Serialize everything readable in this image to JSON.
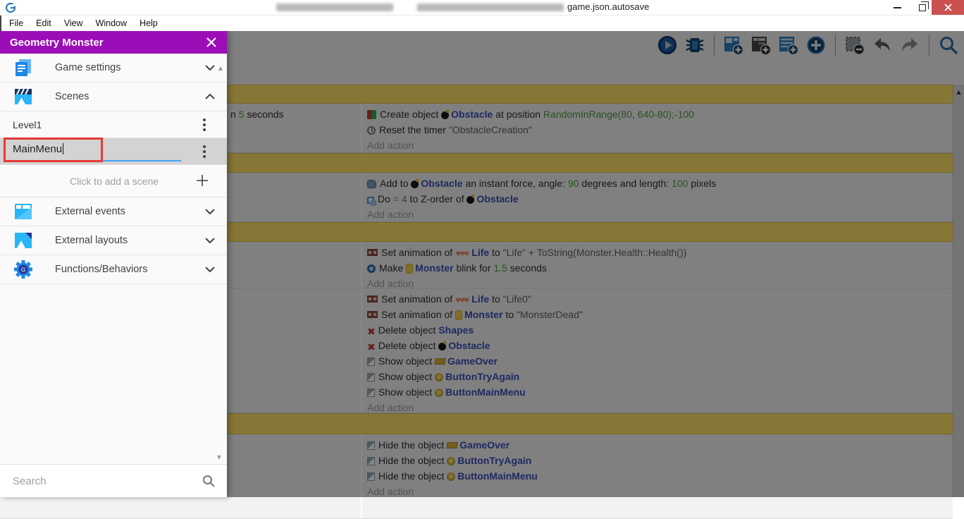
{
  "window": {
    "title": "game.json.autosave",
    "controls": [
      "minimize-button",
      "restore-button",
      "close-button"
    ]
  },
  "menu": {
    "items": [
      "File",
      "Edit",
      "View",
      "Window",
      "Help"
    ]
  },
  "toolbar": {
    "icons": [
      "play",
      "debug",
      "add-event",
      "add-subevent",
      "add-comment-event",
      "add-other-event",
      "remove-event",
      "undo",
      "redo",
      "search"
    ],
    "separators_after": [
      1,
      5,
      8
    ]
  },
  "sidebar": {
    "title": "Geometry Monster",
    "sections_top": [
      {
        "label": "Game settings",
        "icon": "game-settings-icon",
        "chevron": "down"
      },
      {
        "label": "Scenes",
        "icon": "scenes-icon",
        "chevron": "up"
      }
    ],
    "scenes": [
      {
        "label": "Level1",
        "editing": false
      },
      {
        "label": "MainMenu",
        "editing": true
      }
    ],
    "add_scene_label": "Click to add a scene",
    "sections_bottom": [
      {
        "label": "External events",
        "icon": "external-events-icon",
        "chevron": "down"
      },
      {
        "label": "External layouts",
        "icon": "external-layouts-icon",
        "chevron": "down"
      },
      {
        "label": "Functions/Behaviors",
        "icon": "functions-icon",
        "chevron": "down"
      }
    ],
    "search_placeholder": "Search"
  },
  "labels": {
    "add_action": "Add action"
  },
  "colors": {
    "drawer_header": "#9c0db7",
    "annotation": "#e53935",
    "edit_underline": "#42a5f5",
    "comment_bar": "#ffe066",
    "object_link": "#3a4fb4",
    "expression": "#4f9d3c",
    "close_button": "#cb5151"
  },
  "events": [
    {
      "type": "comment",
      "h": 27
    },
    {
      "type": "event",
      "h": 70,
      "conditions": [
        [
          {
            "t": "n "
          },
          {
            "t": "5",
            "k": "expr"
          },
          {
            "t": " seconds"
          }
        ]
      ],
      "actions": [
        {
          "icon": "create",
          "segs": [
            {
              "t": "Create object "
            },
            {
              "obj_icon": "bomb"
            },
            {
              "t": "Obstacle",
              "k": "obj"
            },
            {
              "t": " at position "
            },
            {
              "t": "RandomInRange(80, 640-80);-100",
              "k": "expr"
            }
          ]
        },
        {
          "icon": "timer",
          "segs": [
            {
              "t": "Reset the timer "
            },
            {
              "t": "\"ObstacleCreation\"",
              "k": "str"
            }
          ]
        }
      ]
    },
    {
      "type": "comment",
      "h": 28
    },
    {
      "type": "event",
      "h": 70,
      "conditions": [],
      "actions": [
        {
          "icon": "force",
          "segs": [
            {
              "t": "Add to "
            },
            {
              "obj_icon": "bomb"
            },
            {
              "t": "Obstacle",
              "k": "obj"
            },
            {
              "t": " an instant force, angle: "
            },
            {
              "t": "90",
              "k": "expr"
            },
            {
              "t": " degrees and length: "
            },
            {
              "t": "100",
              "k": "expr"
            },
            {
              "t": " pixels"
            }
          ]
        },
        {
          "icon": "zorder",
          "segs": [
            {
              "t": "Do "
            },
            {
              "t": "= ",
              "k": "op"
            },
            {
              "t": "4",
              "k": "expr"
            },
            {
              "t": " to Z-order of "
            },
            {
              "obj_icon": "bomb"
            },
            {
              "t": "Obstacle",
              "k": "obj"
            }
          ]
        }
      ]
    },
    {
      "type": "comment",
      "h": 28
    },
    {
      "type": "event",
      "h": 66,
      "conditions": [],
      "actions": [
        {
          "icon": "anim",
          "segs": [
            {
              "t": "Set animation of "
            },
            {
              "obj_icon": "hearts"
            },
            {
              "t": "Life",
              "k": "obj"
            },
            {
              "t": " to "
            },
            {
              "t": "\"Life\" + ToString(Monster.Health::Health())",
              "k": "str"
            }
          ]
        },
        {
          "icon": "blink",
          "segs": [
            {
              "t": "Make "
            },
            {
              "obj_icon": "monster"
            },
            {
              "t": "Monster",
              "k": "obj"
            },
            {
              "t": " blink for "
            },
            {
              "t": "1.5",
              "k": "expr"
            },
            {
              "t": " seconds"
            }
          ]
        }
      ]
    },
    {
      "type": "event",
      "h": 177,
      "conditions": [],
      "actions": [
        {
          "icon": "anim",
          "segs": [
            {
              "t": "Set animation of "
            },
            {
              "obj_icon": "hearts"
            },
            {
              "t": "Life",
              "k": "obj"
            },
            {
              "t": " to "
            },
            {
              "t": "\"Life0\"",
              "k": "str"
            }
          ]
        },
        {
          "icon": "anim",
          "segs": [
            {
              "t": "Set animation of "
            },
            {
              "obj_icon": "monster"
            },
            {
              "t": "Monster",
              "k": "obj"
            },
            {
              "t": " to "
            },
            {
              "t": "\"MonsterDead\"",
              "k": "str"
            }
          ]
        },
        {
          "icon": "delete",
          "segs": [
            {
              "t": "Delete object "
            },
            {
              "t": "Shapes",
              "k": "obj"
            }
          ]
        },
        {
          "icon": "delete",
          "segs": [
            {
              "t": "Delete object "
            },
            {
              "obj_icon": "bomb"
            },
            {
              "t": "Obstacle",
              "k": "obj"
            }
          ]
        },
        {
          "icon": "visibility",
          "segs": [
            {
              "t": "Show object "
            },
            {
              "obj_icon": "banner"
            },
            {
              "t": "GameOver",
              "k": "obj"
            }
          ]
        },
        {
          "icon": "visibility",
          "segs": [
            {
              "t": "Show object "
            },
            {
              "obj_icon": "coin"
            },
            {
              "t": "ButtonTryAgain",
              "k": "obj"
            }
          ]
        },
        {
          "icon": "visibility",
          "segs": [
            {
              "t": "Show object "
            },
            {
              "obj_icon": "coin"
            },
            {
              "t": "ButtonMainMenu",
              "k": "obj"
            }
          ]
        }
      ]
    },
    {
      "type": "comment",
      "h": 30
    },
    {
      "type": "event",
      "h": 120,
      "conditions": [],
      "actions": [
        {
          "icon": "visibility",
          "segs": [
            {
              "t": "Hide the object "
            },
            {
              "obj_icon": "banner"
            },
            {
              "t": "GameOver",
              "k": "obj"
            }
          ]
        },
        {
          "icon": "visibility",
          "segs": [
            {
              "t": "Hide the object "
            },
            {
              "obj_icon": "coin"
            },
            {
              "t": "ButtonTryAgain",
              "k": "obj"
            }
          ]
        },
        {
          "icon": "visibility",
          "segs": [
            {
              "t": "Hide the object "
            },
            {
              "obj_icon": "coin"
            },
            {
              "t": "ButtonMainMenu",
              "k": "obj"
            }
          ]
        }
      ]
    }
  ]
}
